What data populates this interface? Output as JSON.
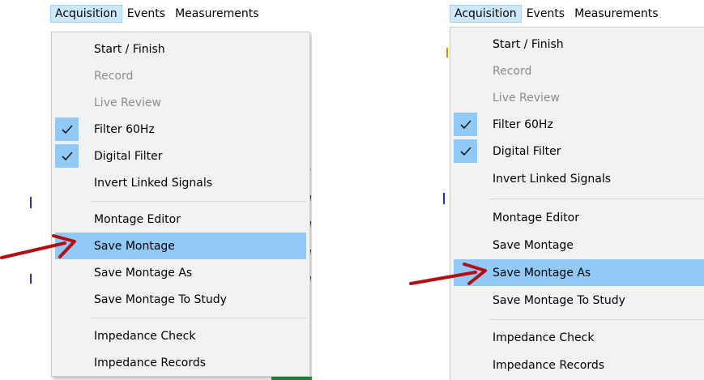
{
  "menubar": {
    "items": [
      {
        "label": "Acquisition",
        "active": true
      },
      {
        "label": "Events"
      },
      {
        "label": "Measurements"
      }
    ]
  },
  "menu": {
    "start_finish": "Start / Finish",
    "record": "Record",
    "live_review": "Live Review",
    "filter_60hz": "Filter 60Hz",
    "digital_filter": "Digital Filter",
    "invert_linked": "Invert Linked Signals",
    "montage_editor": "Montage Editor",
    "save_montage": "Save Montage",
    "save_montage_as": "Save Montage As",
    "save_montage_to_study": "Save Montage To Study",
    "impedance_check": "Impedance Check",
    "impedance_records": "Impedance Records"
  },
  "state": {
    "left_highlighted": "Save Montage",
    "right_highlighted": "Save Montage As",
    "checked": [
      "Filter 60Hz",
      "Digital Filter"
    ],
    "disabled": [
      "Record",
      "Live Review"
    ]
  },
  "colors": {
    "highlight": "#91c9f7",
    "menubar_active": "#cce8ff",
    "arrow": "#b40d14",
    "menu_bg": "#f2f2f2",
    "disabled_text": "#8c8c8c"
  }
}
